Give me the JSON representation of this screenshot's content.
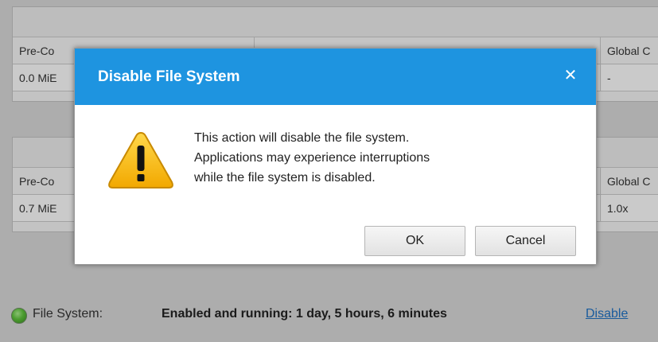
{
  "background": {
    "panel1": {
      "header_left": "Pre-Co",
      "header_right": "Global C",
      "value_left": "0.0 MiE",
      "value_right": "-"
    },
    "panel2": {
      "header_left": "Pre-Co",
      "header_right": "Global C",
      "value_left": "0.7 MiE",
      "value_right": "1.0x"
    }
  },
  "dialog": {
    "title": "Disable File System",
    "close_symbol": "✕",
    "icon": "warning-icon",
    "message_lines": [
      "This action will disable the file system.",
      "Applications may experience interruptions",
      "while the file system is disabled."
    ],
    "ok_label": "OK",
    "cancel_label": "Cancel"
  },
  "status_bar": {
    "indicator_icon": "status-led-icon",
    "label": "File System:",
    "status": "Enabled and running: 1 day, 5 hours, 6 minutes",
    "action_link": "Disable"
  },
  "colors": {
    "titlebar": "#1e94e0",
    "warning": "#f5b400",
    "link": "#1f6fbf",
    "status_led": "#5cbf3a"
  }
}
